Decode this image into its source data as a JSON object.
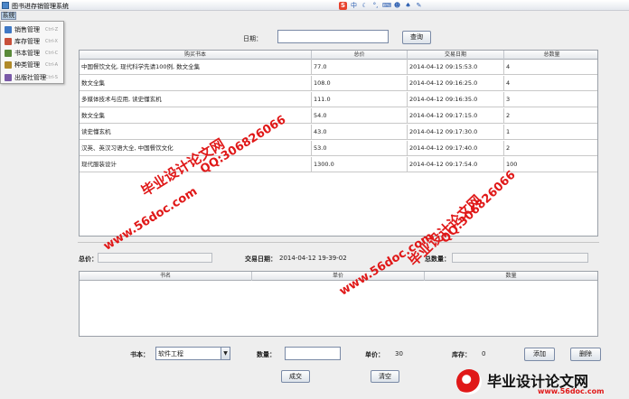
{
  "window": {
    "title": "图书进存销管理系统"
  },
  "ime_toolbar": [
    {
      "icon": "sogou-s-icon",
      "glyph": "S"
    },
    {
      "icon": "chinese-mode-icon",
      "glyph": "中"
    },
    {
      "icon": "moon-icon",
      "glyph": "☾"
    },
    {
      "icon": "punctuation-icon",
      "glyph": "°,"
    },
    {
      "icon": "keyboard-icon",
      "glyph": "⌨"
    },
    {
      "icon": "user-icon",
      "glyph": "☻"
    },
    {
      "icon": "shirt-icon",
      "glyph": "♠"
    },
    {
      "icon": "wrench-icon",
      "glyph": "✎"
    }
  ],
  "menubar": {
    "system": "系统"
  },
  "dropdown": [
    {
      "label": "销售管理",
      "shortcut": "Ctrl-Z",
      "color": "#3f78c4"
    },
    {
      "label": "库存管理",
      "shortcut": "Ctrl-X",
      "color": "#c8503a"
    },
    {
      "label": "书本管理",
      "shortcut": "Ctrl-C",
      "color": "#5a8a3a"
    },
    {
      "label": "种类管理",
      "shortcut": "Ctrl-A",
      "color": "#b08a2a"
    },
    {
      "label": "出版社管理",
      "shortcut": "Ctrl-S",
      "color": "#7a5aa8"
    }
  ],
  "search": {
    "date_label": "日期：",
    "date_value": "",
    "query_button": "查询"
  },
  "table1": {
    "headers": [
      "购买书本",
      "总价",
      "交易日期",
      "总数量"
    ],
    "rows": [
      [
        "中国餐饮文化, 现代科学先请100例, 数文全集",
        "77.0",
        "2014-04-12 09:15:53.0",
        "4"
      ],
      [
        "数文全集",
        "108.0",
        "2014-04-12 09:16:25.0",
        "4"
      ],
      [
        "多媒体技术与应用, 读史懂玄机",
        "111.0",
        "2014-04-12 09:16:35.0",
        "3"
      ],
      [
        "数文全集",
        "54.0",
        "2014-04-12 09:17:15.0",
        "2"
      ],
      [
        "读史懂玄机",
        "43.0",
        "2014-04-12 09:17:30.0",
        "1"
      ],
      [
        "汉英、英汉习语大全, 中国餐饮文化",
        "53.0",
        "2014-04-12 09:17:40.0",
        "2"
      ],
      [
        "现代服装设计",
        "1300.0",
        "2014-04-12 09:17:54.0",
        "100"
      ]
    ]
  },
  "summary": {
    "total_price_label": "总价：",
    "total_price_value": "",
    "date_label": "交易日期：",
    "date_value": "2014-04-12 19-39-02",
    "total_qty_label": "总数量：",
    "total_qty_value": ""
  },
  "table2": {
    "headers": [
      "书名",
      "单价",
      "数量"
    ]
  },
  "form": {
    "book_label": "书本：",
    "book_value": "软件工程",
    "qty_label": "数量：",
    "qty_value": "",
    "unit_price_label": "单价：",
    "unit_price_value": "30",
    "stock_label": "库存：",
    "stock_value": "0",
    "add_button": "添加",
    "delete_button": "删除",
    "deal_button": "成交",
    "clear_button": "清空"
  },
  "watermarks": {
    "text_title": "毕业设计论文网",
    "text_qq": "QQ:306826066",
    "text_url": "www.56doc.com",
    "logo_title": "毕业设计论文网",
    "logo_url": "www.56doc.com"
  }
}
